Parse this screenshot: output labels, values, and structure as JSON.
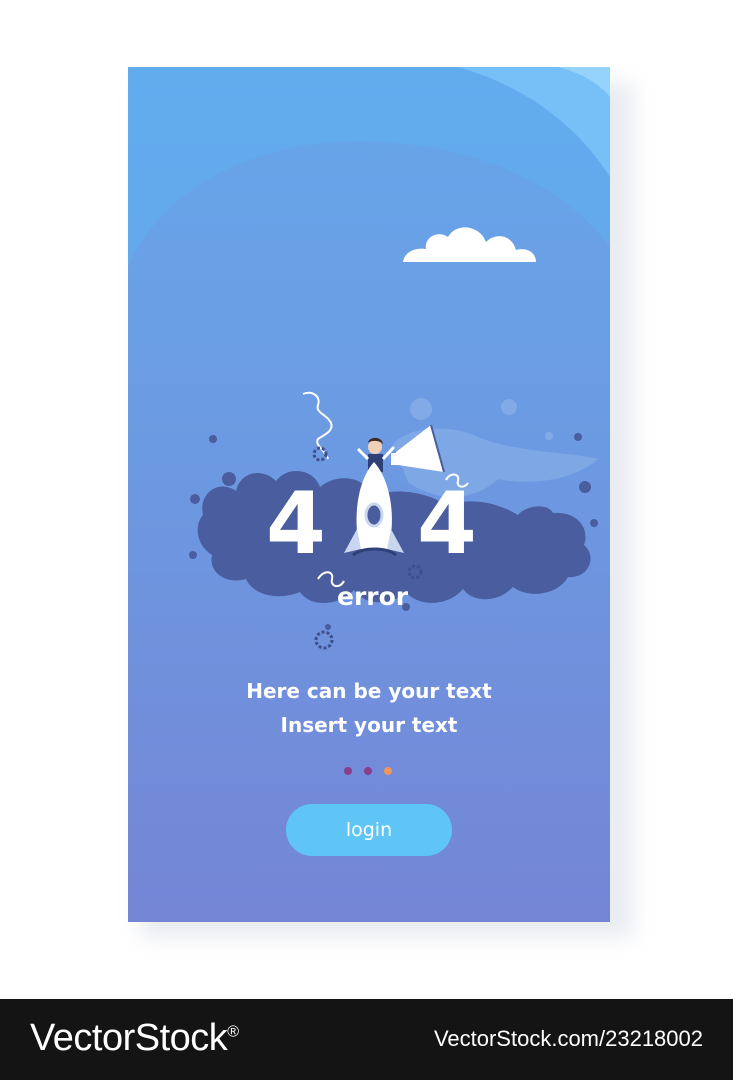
{
  "error": {
    "code_first": "4",
    "code_last": "4",
    "word": "error"
  },
  "message": {
    "line1": "Here can be your text",
    "line2": "Insert your text"
  },
  "pager": {
    "dots": [
      "#8a3d8c",
      "#8a3d8c",
      "#f0965a"
    ]
  },
  "login": {
    "label": "login"
  },
  "footer": {
    "brand": "VectorStock",
    "registered": "®",
    "image_id": "VectorStock.com/23218002"
  },
  "colors": {
    "accent": "#5ec5f6",
    "screen_top": "#66a6ea",
    "screen_bottom": "#7585d6",
    "blob": "#4a5d9e",
    "footer": "#141414"
  },
  "icons": [
    "cloud-icon",
    "rocket-icon",
    "gear-icon",
    "megaphone-icon",
    "spring-icon"
  ]
}
